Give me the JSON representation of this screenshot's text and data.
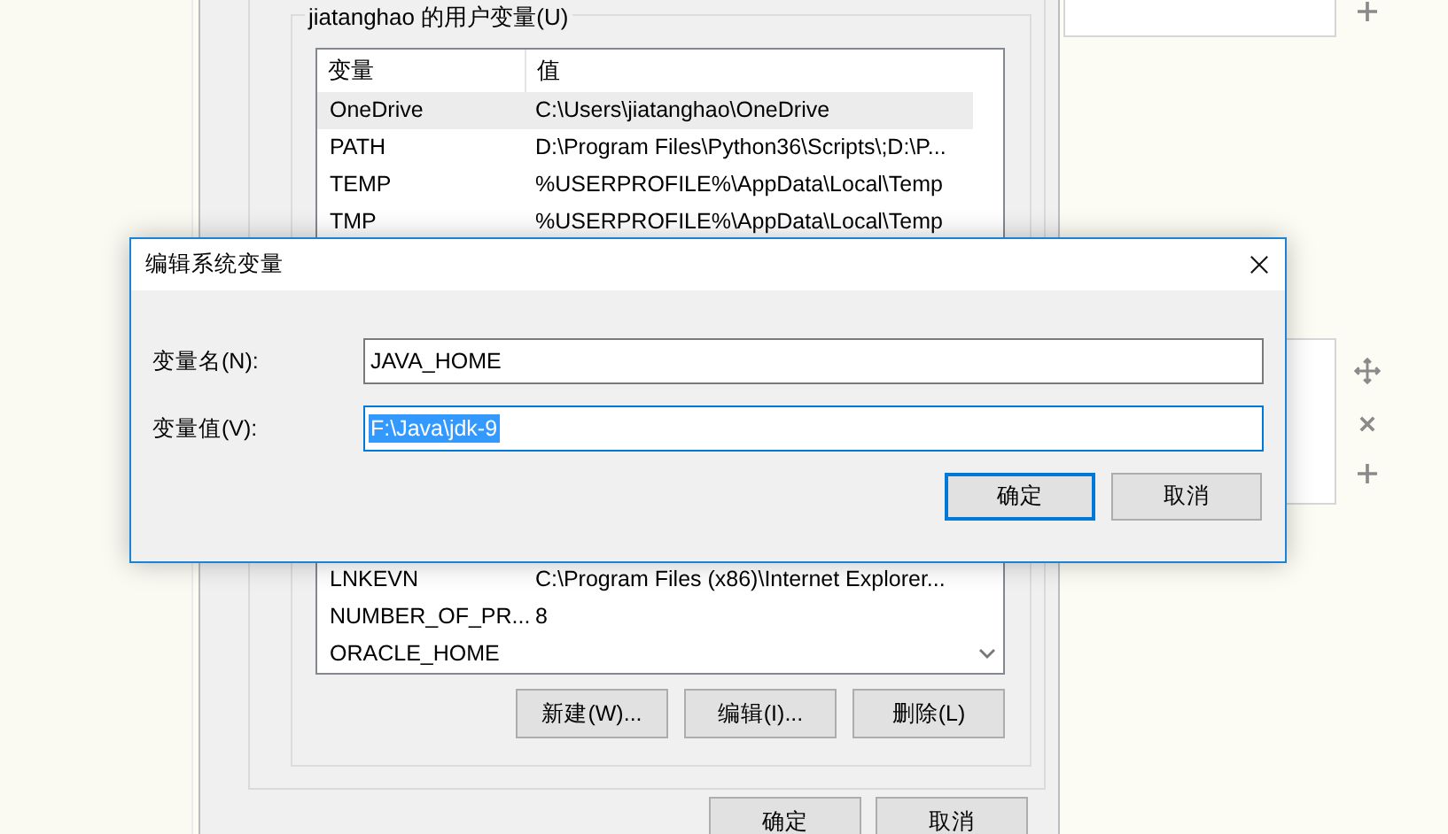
{
  "env_window": {
    "group_title": "jiatanghao 的用户变量(U)",
    "columns": [
      "变量",
      "值"
    ],
    "rows_top": [
      {
        "name": "OneDrive",
        "value": "C:\\Users\\jiatanghao\\OneDrive",
        "selected": true
      },
      {
        "name": "PATH",
        "value": "D:\\Program Files\\Python36\\Scripts\\;D:\\P...",
        "selected": false
      },
      {
        "name": "TEMP",
        "value": "%USERPROFILE%\\AppData\\Local\\Temp",
        "selected": false
      },
      {
        "name": "TMP",
        "value": "%USERPROFILE%\\AppData\\Local\\Temp",
        "selected": false
      }
    ],
    "rows_bottom": [
      {
        "name": "LNKEVN",
        "value": "C:\\Program Files (x86)\\Internet Explorer...",
        "selected": false
      },
      {
        "name": "NUMBER_OF_PR...",
        "value": "8",
        "selected": false
      },
      {
        "name": "ORACLE_HOME",
        "selected": false
      }
    ],
    "buttons": [
      "新建(W)...",
      "编辑(I)...",
      "删除(L)"
    ],
    "footer_buttons": [
      "确定",
      "取消"
    ]
  },
  "dialog": {
    "title": "编辑系统变量",
    "fields": [
      {
        "label": "变量名(N):",
        "value": "JAVA_HOME",
        "focused": false,
        "value_selected": false
      },
      {
        "label": "变量值(V):",
        "value": "F:\\Java\\jdk-9",
        "focused": true,
        "value_selected": true
      }
    ],
    "buttons": [
      {
        "label": "确定",
        "default": true
      },
      {
        "label": "取消",
        "default": false
      }
    ]
  }
}
